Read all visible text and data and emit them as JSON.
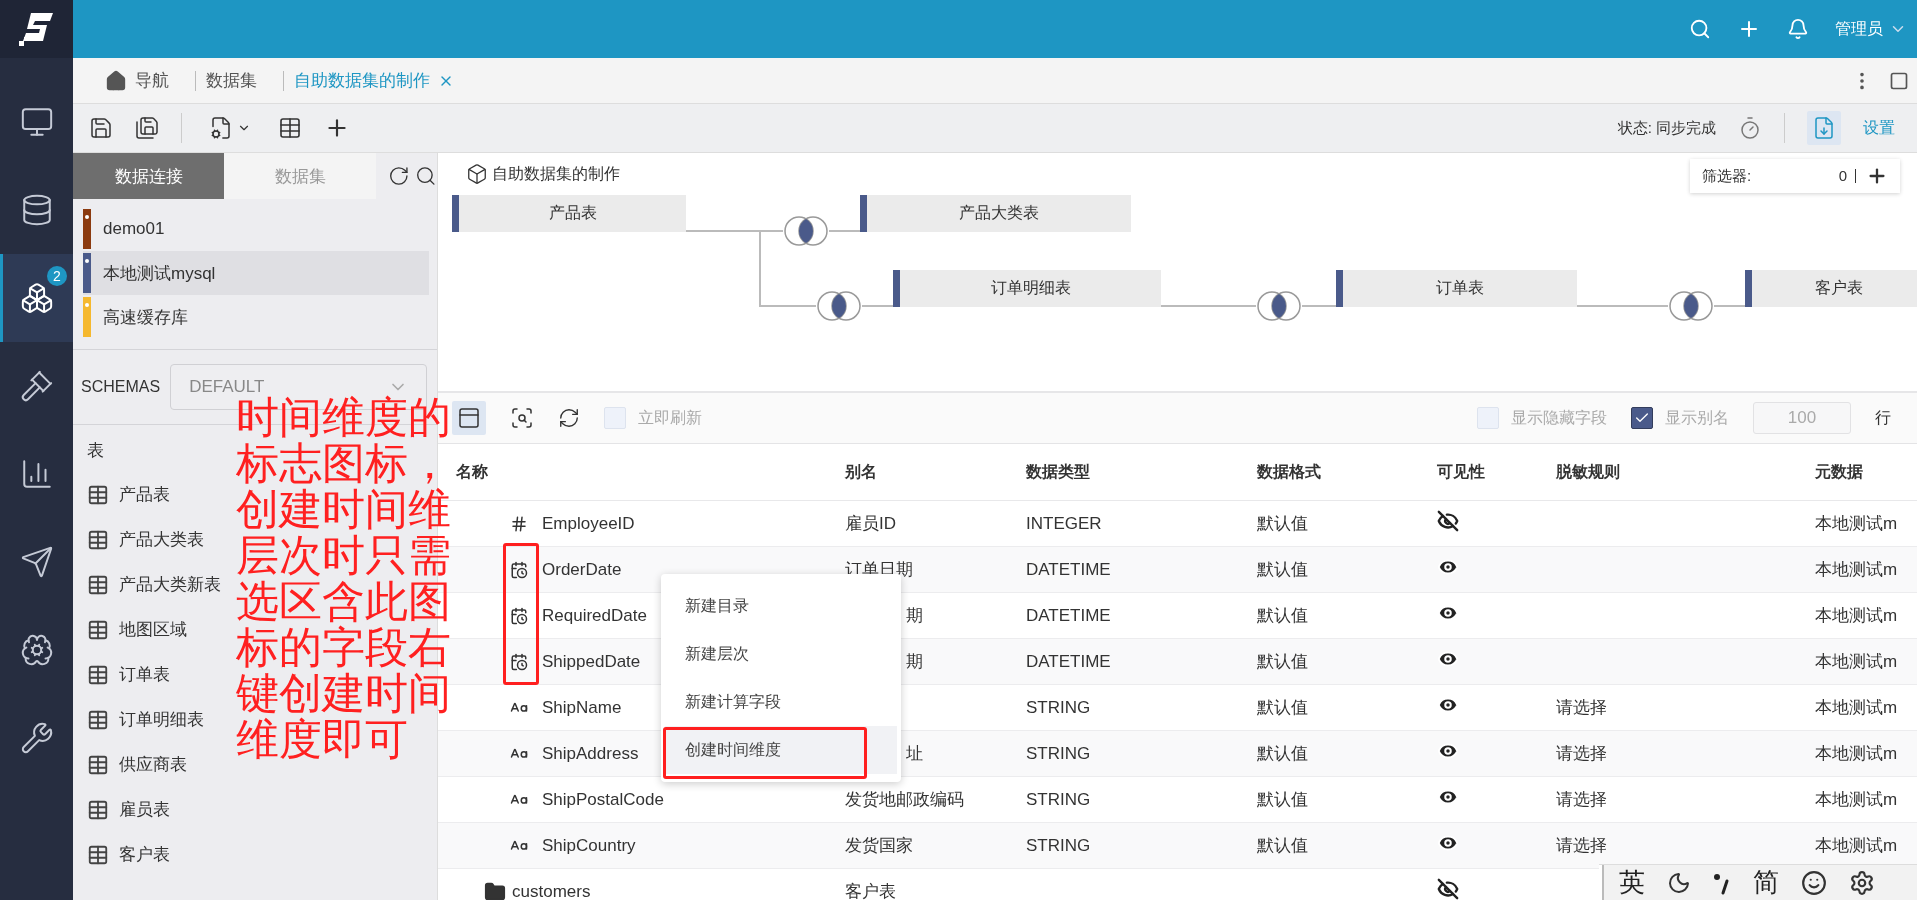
{
  "top_bar": {
    "user": "管理员"
  },
  "nav_rail": {
    "items": [
      {
        "kind": "monitor",
        "selected": false
      },
      {
        "kind": "database",
        "selected": false
      },
      {
        "kind": "cubes",
        "selected": true,
        "badge": "2"
      },
      {
        "kind": "gavel",
        "selected": false
      },
      {
        "kind": "chart",
        "selected": false
      },
      {
        "kind": "send",
        "selected": false
      },
      {
        "kind": "brain",
        "selected": false
      },
      {
        "kind": "tools",
        "selected": false
      }
    ]
  },
  "tabs": [
    {
      "label": "导航",
      "kind": "home",
      "selected": false
    },
    {
      "label": "数据集",
      "kind": "plain",
      "selected": false
    },
    {
      "label": "自助数据集的制作",
      "kind": "closable",
      "selected": true
    }
  ],
  "toolbar": {
    "status": "状态: 同步完成",
    "settings": "设置"
  },
  "left_panel": {
    "tabs": [
      {
        "label": "数据连接",
        "selected": true
      },
      {
        "label": "数据集",
        "selected": false
      }
    ],
    "connections": [
      {
        "name": "demo01",
        "color": "#8b3a0f",
        "selected": false
      },
      {
        "name": "本地测试mysql",
        "color": "#4a5a8a",
        "selected": true
      },
      {
        "name": "高速缓存库",
        "color": "#f5b82e",
        "selected": false
      }
    ],
    "schemas_label": "SCHEMAS",
    "schema": "DEFAULT",
    "tables_heading": "表",
    "tables": [
      "产品表",
      "产品大类表",
      "产品大类新表",
      "地图区域",
      "订单表",
      "订单明细表",
      "供应商表",
      "雇员表",
      "客户表"
    ]
  },
  "canvas": {
    "title": "自助数据集的制作",
    "filter_label": "筛选器:",
    "filter_count": "0",
    "nodes": [
      {
        "label": "产品表"
      },
      {
        "label": "产品大类表"
      },
      {
        "label": "订单明细表"
      },
      {
        "label": "订单表"
      },
      {
        "label": "客户表"
      }
    ]
  },
  "grid_toolbar": {
    "refresh_now": {
      "label": "立即刷新",
      "checked": false
    },
    "show_hidden": {
      "label": "显示隐藏字段",
      "checked": false
    },
    "show_alias": {
      "label": "显示别名",
      "checked": true
    },
    "row_limit": "100",
    "row_unit": "行"
  },
  "table": {
    "columns": [
      "名称",
      "别名",
      "数据类型",
      "数据格式",
      "可见性",
      "脱敏规则",
      "元数据"
    ],
    "rows": [
      {
        "kind": "number",
        "name": "EmployeeID",
        "alias": "雇员ID",
        "type": "INTEGER",
        "format": "默认值",
        "visible": false,
        "meta": "本地测试m"
      },
      {
        "kind": "date",
        "name": "OrderDate",
        "alias": "订单日期",
        "type": "DATETIME",
        "format": "默认值",
        "visible": true,
        "meta": "本地测试m"
      },
      {
        "kind": "date",
        "name": "RequiredDate",
        "alias": "期",
        "covered": true,
        "type": "DATETIME",
        "format": "默认值",
        "visible": true,
        "meta": "本地测试m"
      },
      {
        "kind": "date",
        "name": "ShippedDate",
        "alias": "期",
        "covered": true,
        "type": "DATETIME",
        "format": "默认值",
        "visible": true,
        "meta": "本地测试m"
      },
      {
        "kind": "string",
        "name": "ShipName",
        "type": "STRING",
        "format": "默认值",
        "visible": true,
        "mask": "请选择",
        "meta": "本地测试m"
      },
      {
        "kind": "string",
        "name": "ShipAddress",
        "alias": "址",
        "covered": true,
        "type": "STRING",
        "format": "默认值",
        "visible": true,
        "mask": "请选择",
        "meta": "本地测试m"
      },
      {
        "kind": "string",
        "name": "ShipPostalCode",
        "alias": "发货地邮政编码",
        "type": "STRING",
        "format": "默认值",
        "visible": true,
        "mask": "请选择",
        "meta": "本地测试m"
      },
      {
        "kind": "string",
        "name": "ShipCountry",
        "alias": "发货国家",
        "type": "STRING",
        "format": "默认值",
        "visible": true,
        "mask": "请选择",
        "meta": "本地测试m"
      },
      {
        "kind": "folder",
        "name": "customers",
        "alias": "客户表",
        "visible": false
      }
    ]
  },
  "context_menu": {
    "items": [
      {
        "label": "新建目录",
        "highlighted": false
      },
      {
        "label": "新建层次",
        "highlighted": false
      },
      {
        "label": "新建计算字段",
        "highlighted": false
      },
      {
        "label": "创建时间维度",
        "highlighted": true
      }
    ]
  },
  "annotation": {
    "text": "时间维度的标志图标，创建时间维层次时只需选区含此图标的字段右键创建时间维度即可"
  },
  "ime_bar": {
    "items": [
      {
        "kind": "text",
        "label": "英"
      },
      {
        "kind": "moon"
      },
      {
        "kind": "punct"
      },
      {
        "kind": "text",
        "label": "简"
      },
      {
        "kind": "smile"
      },
      {
        "kind": "gear"
      }
    ]
  }
}
